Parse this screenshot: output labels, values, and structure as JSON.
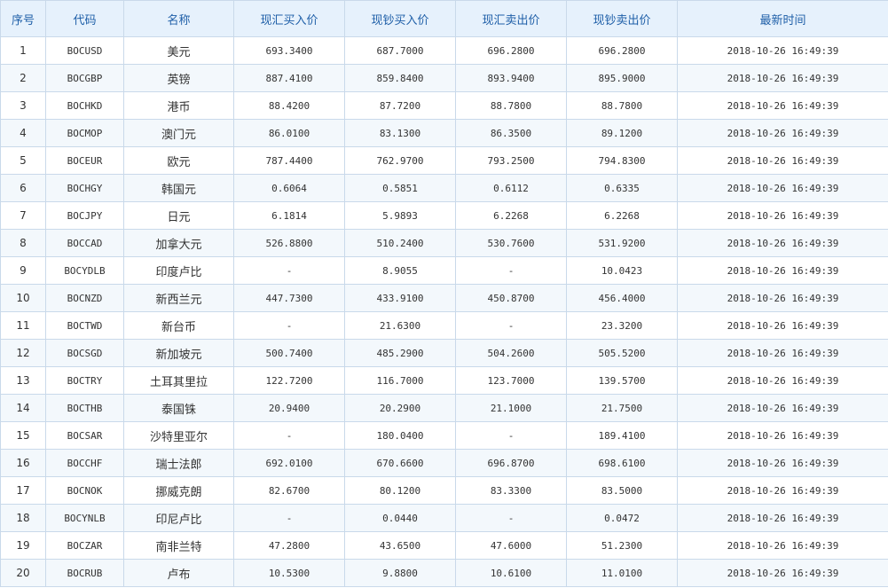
{
  "table": {
    "headers": [
      "序号",
      "代码",
      "名称",
      "现汇买入价",
      "现钞买入价",
      "现汇卖出价",
      "现钞卖出价",
      "最新时间"
    ],
    "rows": [
      [
        "1",
        "BOCUSD",
        "美元",
        "693.3400",
        "687.7000",
        "696.2800",
        "696.2800",
        "2018-10-26 16:49:39"
      ],
      [
        "2",
        "BOCGBP",
        "英镑",
        "887.4100",
        "859.8400",
        "893.9400",
        "895.9000",
        "2018-10-26 16:49:39"
      ],
      [
        "3",
        "BOCHKD",
        "港币",
        "88.4200",
        "87.7200",
        "88.7800",
        "88.7800",
        "2018-10-26 16:49:39"
      ],
      [
        "4",
        "BOCMOP",
        "澳门元",
        "86.0100",
        "83.1300",
        "86.3500",
        "89.1200",
        "2018-10-26 16:49:39"
      ],
      [
        "5",
        "BOCEUR",
        "欧元",
        "787.4400",
        "762.9700",
        "793.2500",
        "794.8300",
        "2018-10-26 16:49:39"
      ],
      [
        "6",
        "BOCHGY",
        "韩国元",
        "0.6064",
        "0.5851",
        "0.6112",
        "0.6335",
        "2018-10-26 16:49:39"
      ],
      [
        "7",
        "BOCJPY",
        "日元",
        "6.1814",
        "5.9893",
        "6.2268",
        "6.2268",
        "2018-10-26 16:49:39"
      ],
      [
        "8",
        "BOCCAD",
        "加拿大元",
        "526.8800",
        "510.2400",
        "530.7600",
        "531.9200",
        "2018-10-26 16:49:39"
      ],
      [
        "9",
        "BOCYDLB",
        "印度卢比",
        "-",
        "8.9055",
        "-",
        "10.0423",
        "2018-10-26 16:49:39"
      ],
      [
        "10",
        "BOCNZD",
        "新西兰元",
        "447.7300",
        "433.9100",
        "450.8700",
        "456.4000",
        "2018-10-26 16:49:39"
      ],
      [
        "11",
        "BOCTWD",
        "新台币",
        "-",
        "21.6300",
        "-",
        "23.3200",
        "2018-10-26 16:49:39"
      ],
      [
        "12",
        "BOCSGD",
        "新加坡元",
        "500.7400",
        "485.2900",
        "504.2600",
        "505.5200",
        "2018-10-26 16:49:39"
      ],
      [
        "13",
        "BOCTRY",
        "土耳其里拉",
        "122.7200",
        "116.7000",
        "123.7000",
        "139.5700",
        "2018-10-26 16:49:39"
      ],
      [
        "14",
        "BOCTHB",
        "泰国铢",
        "20.9400",
        "20.2900",
        "21.1000",
        "21.7500",
        "2018-10-26 16:49:39"
      ],
      [
        "15",
        "BOCSAR",
        "沙特里亚尔",
        "-",
        "180.0400",
        "-",
        "189.4100",
        "2018-10-26 16:49:39"
      ],
      [
        "16",
        "BOCCHF",
        "瑞士法郎",
        "692.0100",
        "670.6600",
        "696.8700",
        "698.6100",
        "2018-10-26 16:49:39"
      ],
      [
        "17",
        "BOCNOK",
        "挪威克朗",
        "82.6700",
        "80.1200",
        "83.3300",
        "83.5000",
        "2018-10-26 16:49:39"
      ],
      [
        "18",
        "BOCYNLB",
        "印尼卢比",
        "-",
        "0.0440",
        "-",
        "0.0472",
        "2018-10-26 16:49:39"
      ],
      [
        "19",
        "BOCZAR",
        "南非兰特",
        "47.2800",
        "43.6500",
        "47.6000",
        "51.2300",
        "2018-10-26 16:49:39"
      ],
      [
        "20",
        "BOCRUB",
        "卢布",
        "10.5300",
        "9.8800",
        "10.6100",
        "11.0100",
        "2018-10-26 16:49:39"
      ]
    ]
  }
}
